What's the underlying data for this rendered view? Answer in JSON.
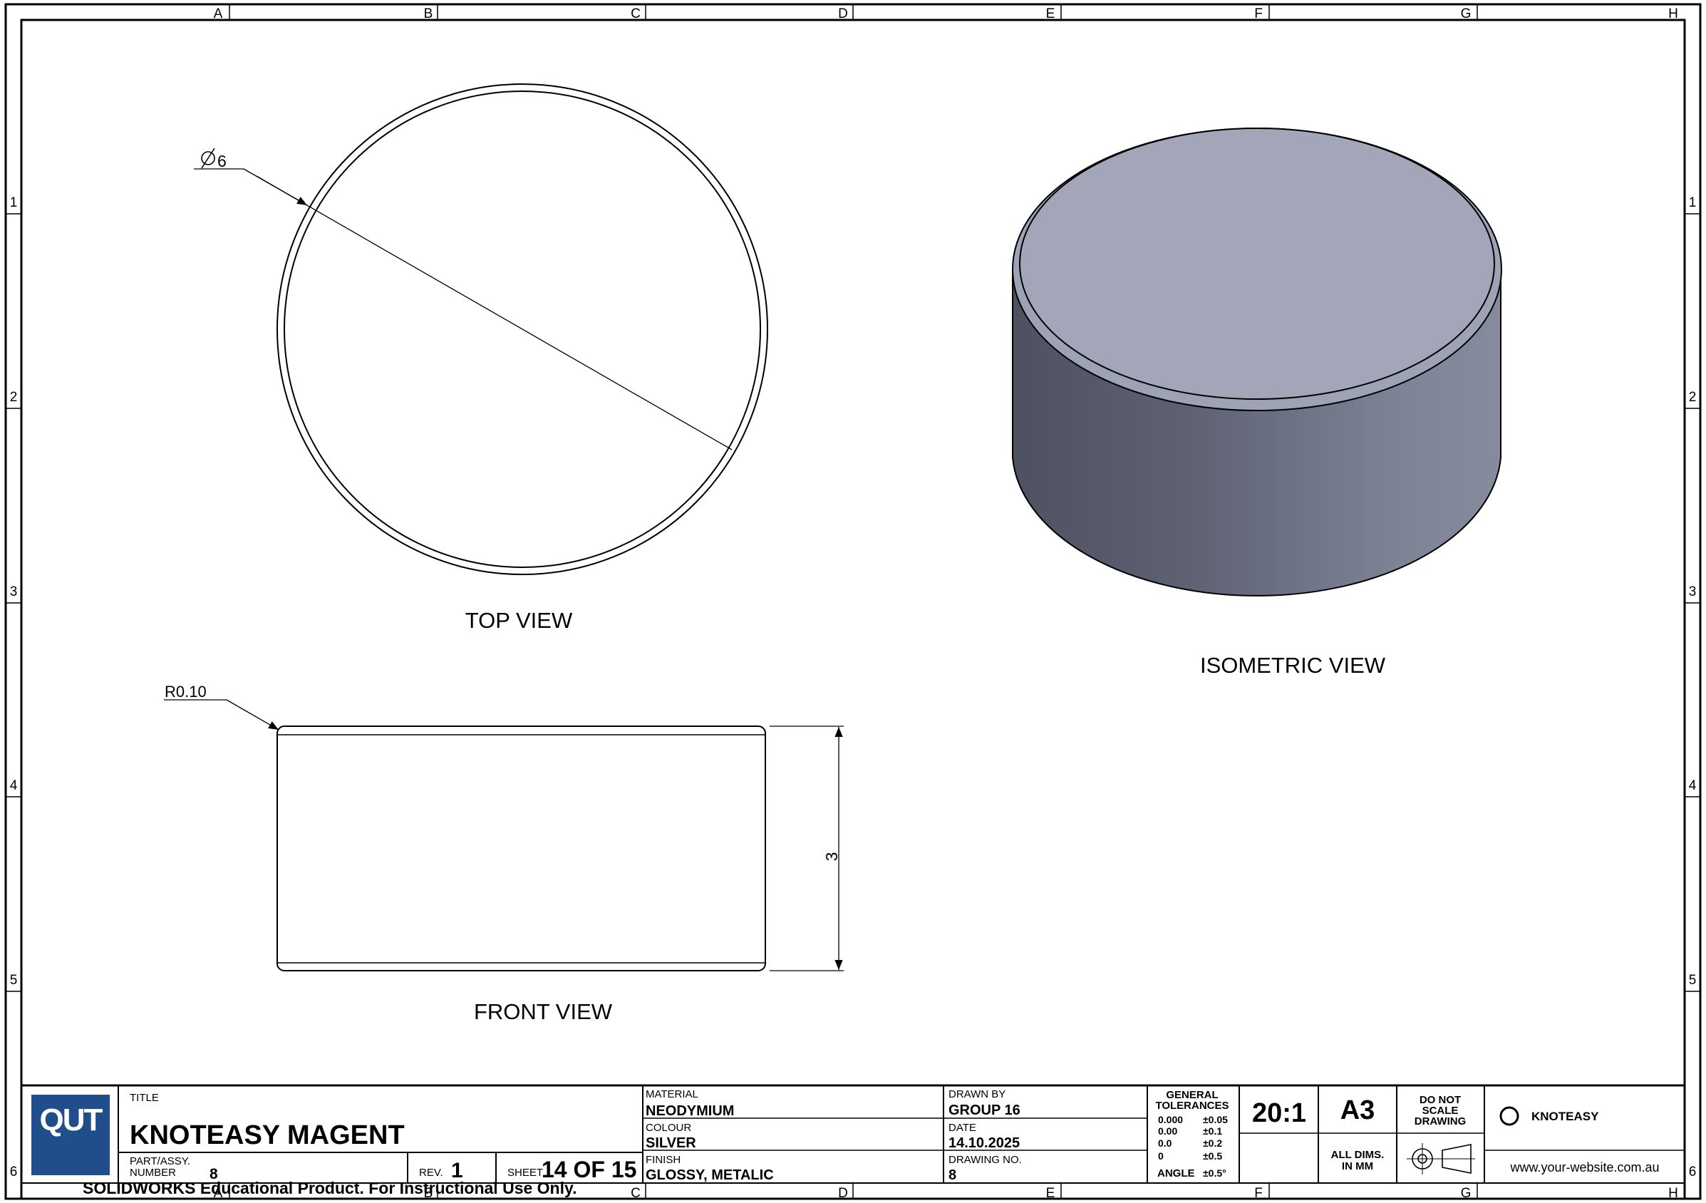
{
  "zones": {
    "columns": [
      "A",
      "B",
      "C",
      "D",
      "E",
      "F",
      "G",
      "H"
    ],
    "rows": [
      "1",
      "2",
      "3",
      "4",
      "5",
      "6"
    ]
  },
  "views": {
    "top": "TOP VIEW",
    "front": "FRONT VIEW",
    "isometric": "ISOMETRIC VIEW"
  },
  "dimensions": {
    "diameter": "6",
    "radius": "R0.10",
    "height": "3"
  },
  "title_block": {
    "logo": "QUT",
    "title_label": "TITLE",
    "title": "KNOTEASY MAGENT",
    "part_label_1": "PART/ASSY.",
    "part_label_2": "NUMBER",
    "part_number": "8",
    "rev_label": "REV.",
    "rev": "1",
    "sheet_label": "SHEET",
    "sheet": "14 OF 15",
    "material_label": "MATERIAL",
    "material": "NEODYMIUM",
    "colour_label": "COLOUR",
    "colour": "SILVER",
    "finish_label": "FINISH",
    "finish": "GLOSSY, METALIC",
    "drawn_by_label": "DRAWN BY",
    "drawn_by": "GROUP 16",
    "date_label": "DATE",
    "date": "14.10.2025",
    "drawing_no_label": "DRAWING NO.",
    "drawing_no": "8",
    "tolerances_label_1": "GENERAL",
    "tolerances_label_2": "TOLERANCES",
    "tolerances": [
      {
        "value": "0.000",
        "tol": "±0.05"
      },
      {
        "value": "0.00",
        "tol": "±0.1"
      },
      {
        "value": "0.0",
        "tol": "±0.2"
      },
      {
        "value": "0",
        "tol": "±0.5"
      }
    ],
    "angle_label": "ANGLE",
    "angle_tol": "±0.5°",
    "scale": "20:1",
    "size": "A3",
    "dns_1": "DO NOT",
    "dns_2": "SCALE",
    "dns_3": "DRAWING",
    "units_1": "ALL DIMS.",
    "units_2": "IN MM",
    "company": "KNOTEASY",
    "website": "www.your-website.com.au"
  },
  "watermark": "SOLIDWORKS Educational Product. For Instructional Use Only.",
  "colors": {
    "logo_bg": "#1f4e8a",
    "iso_top": "#a2a6b8",
    "iso_side_dark": "#4e5160",
    "iso_side_light": "#858a9c"
  }
}
